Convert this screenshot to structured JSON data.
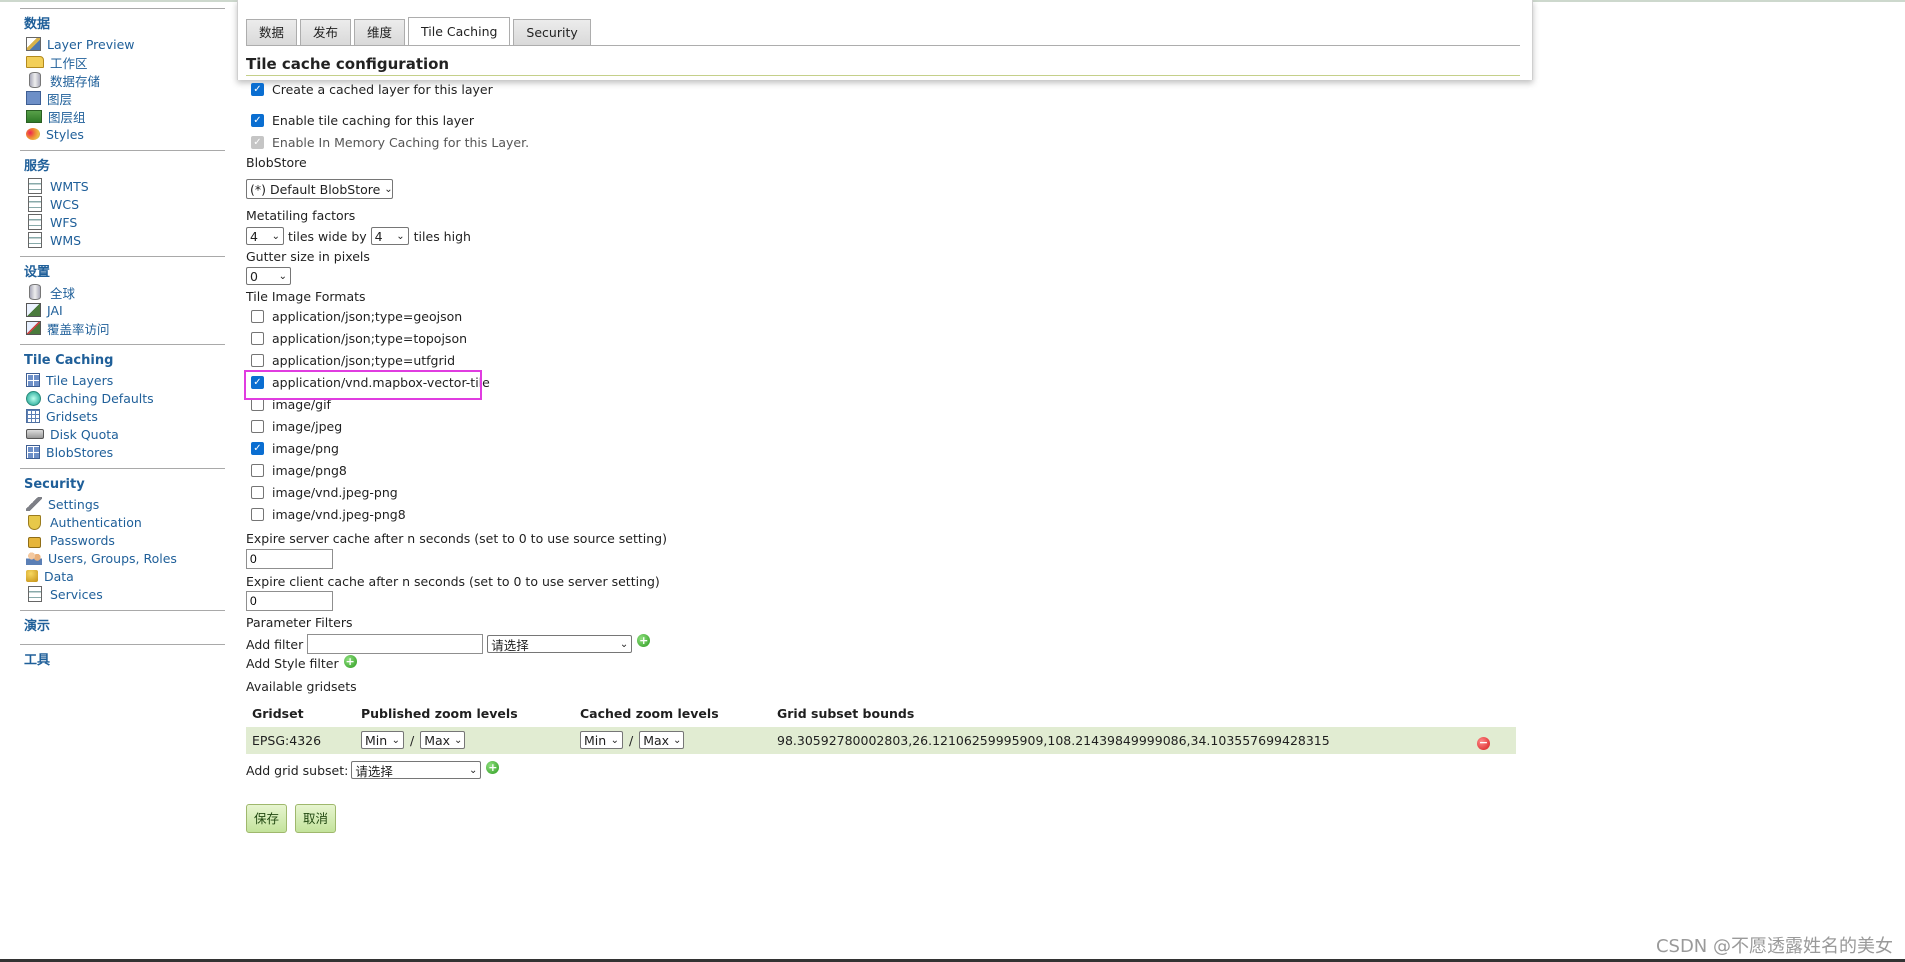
{
  "sidebar": {
    "sections": [
      {
        "head": "数据",
        "items": [
          {
            "label": "Layer Preview",
            "icon": "layer-preview-icon"
          },
          {
            "label": "工作区",
            "icon": "folder-icon"
          },
          {
            "label": "数据存储",
            "icon": "datastore-icon"
          },
          {
            "label": "图层",
            "icon": "layer-icon"
          },
          {
            "label": "图层组",
            "icon": "layer-group-icon"
          },
          {
            "label": "Styles",
            "icon": "styles-icon"
          }
        ]
      },
      {
        "head": "服务",
        "items": [
          {
            "label": "WMTS",
            "icon": "service-icon"
          },
          {
            "label": "WCS",
            "icon": "service-icon"
          },
          {
            "label": "WFS",
            "icon": "service-icon"
          },
          {
            "label": "WMS",
            "icon": "service-icon"
          }
        ]
      },
      {
        "head": "设置",
        "items": [
          {
            "label": "全球",
            "icon": "global-settings-icon"
          },
          {
            "label": "JAI",
            "icon": "jai-icon"
          },
          {
            "label": "覆盖率访问",
            "icon": "coverage-access-icon"
          }
        ]
      },
      {
        "head": "Tile Caching",
        "items": [
          {
            "label": "Tile Layers",
            "icon": "tile-layers-icon"
          },
          {
            "label": "Caching Defaults",
            "icon": "globe-icon"
          },
          {
            "label": "Gridsets",
            "icon": "grid-icon"
          },
          {
            "label": "Disk Quota",
            "icon": "disk-icon"
          },
          {
            "label": "BlobStores",
            "icon": "blobstore-icon"
          }
        ]
      },
      {
        "head": "Security",
        "items": [
          {
            "label": "Settings",
            "icon": "wrench-icon"
          },
          {
            "label": "Authentication",
            "icon": "shield-icon"
          },
          {
            "label": "Passwords",
            "icon": "lock-icon"
          },
          {
            "label": "Users, Groups, Roles",
            "icon": "users-icon"
          },
          {
            "label": "Data",
            "icon": "data-security-icon"
          },
          {
            "label": "Services",
            "icon": "services-security-icon"
          }
        ]
      },
      {
        "head": "演示",
        "items": []
      },
      {
        "head": "工具",
        "items": []
      }
    ]
  },
  "tabs": [
    "数据",
    "发布",
    "维度",
    "Tile Caching",
    "Security"
  ],
  "active_tab": "Tile Caching",
  "section_title": "Tile cache configuration",
  "options": {
    "create_cached_layer": "Create a cached layer for this layer",
    "enable_tile_caching": "Enable tile caching for this layer",
    "enable_in_memory": "Enable In Memory Caching for this Layer."
  },
  "blobstore": {
    "label": "BlobStore",
    "value": "(*) Default BlobStore"
  },
  "metatiling": {
    "label": "Metatiling factors",
    "wide_value": "4",
    "wide_text": "tiles wide by",
    "high_value": "4",
    "high_text": "tiles high"
  },
  "gutter": {
    "label": "Gutter size in pixels",
    "value": "0"
  },
  "formats": {
    "label": "Tile Image Formats",
    "items": [
      {
        "label": "application/json;type=geojson",
        "checked": false
      },
      {
        "label": "application/json;type=topojson",
        "checked": false
      },
      {
        "label": "application/json;type=utfgrid",
        "checked": false
      },
      {
        "label": "application/vnd.mapbox-vector-tile",
        "checked": true
      },
      {
        "label": "image/gif",
        "checked": false
      },
      {
        "label": "image/jpeg",
        "checked": false
      },
      {
        "label": "image/png",
        "checked": true
      },
      {
        "label": "image/png8",
        "checked": false
      },
      {
        "label": "image/vnd.jpeg-png",
        "checked": false
      },
      {
        "label": "image/vnd.jpeg-png8",
        "checked": false
      }
    ]
  },
  "expire_server": {
    "label": "Expire server cache after n seconds (set to 0 to use source setting)",
    "value": "0"
  },
  "expire_client": {
    "label": "Expire client cache after n seconds (set to 0 to use server setting)",
    "value": "0"
  },
  "parameter_filters": {
    "label": "Parameter Filters",
    "add_filter": "Add filter",
    "select_placeholder": "请选择",
    "add_style_filter": "Add Style filter"
  },
  "gridsets": {
    "label": "Available gridsets",
    "headers": [
      "Gridset",
      "Published zoom levels",
      "Cached zoom levels",
      "Grid subset bounds"
    ],
    "row": {
      "name": "EPSG:4326",
      "pub_min": "Min",
      "pub_max": "Max",
      "cache_min": "Min",
      "cache_max": "Max",
      "bounds": "98.30592780002803,26.12106259995909,108.21439849999086,34.103557699428315"
    },
    "add_label": "Add grid subset:",
    "add_placeholder": "请选择"
  },
  "buttons": {
    "save": "保存",
    "cancel": "取消"
  },
  "watermark": "CSDN @不愿透露姓名的美女",
  "colors": {
    "link": "#1f5f99",
    "highlight": "#e03ce0",
    "row_bg": "#e1ecd2",
    "checkbox": "#0a6ed1"
  }
}
